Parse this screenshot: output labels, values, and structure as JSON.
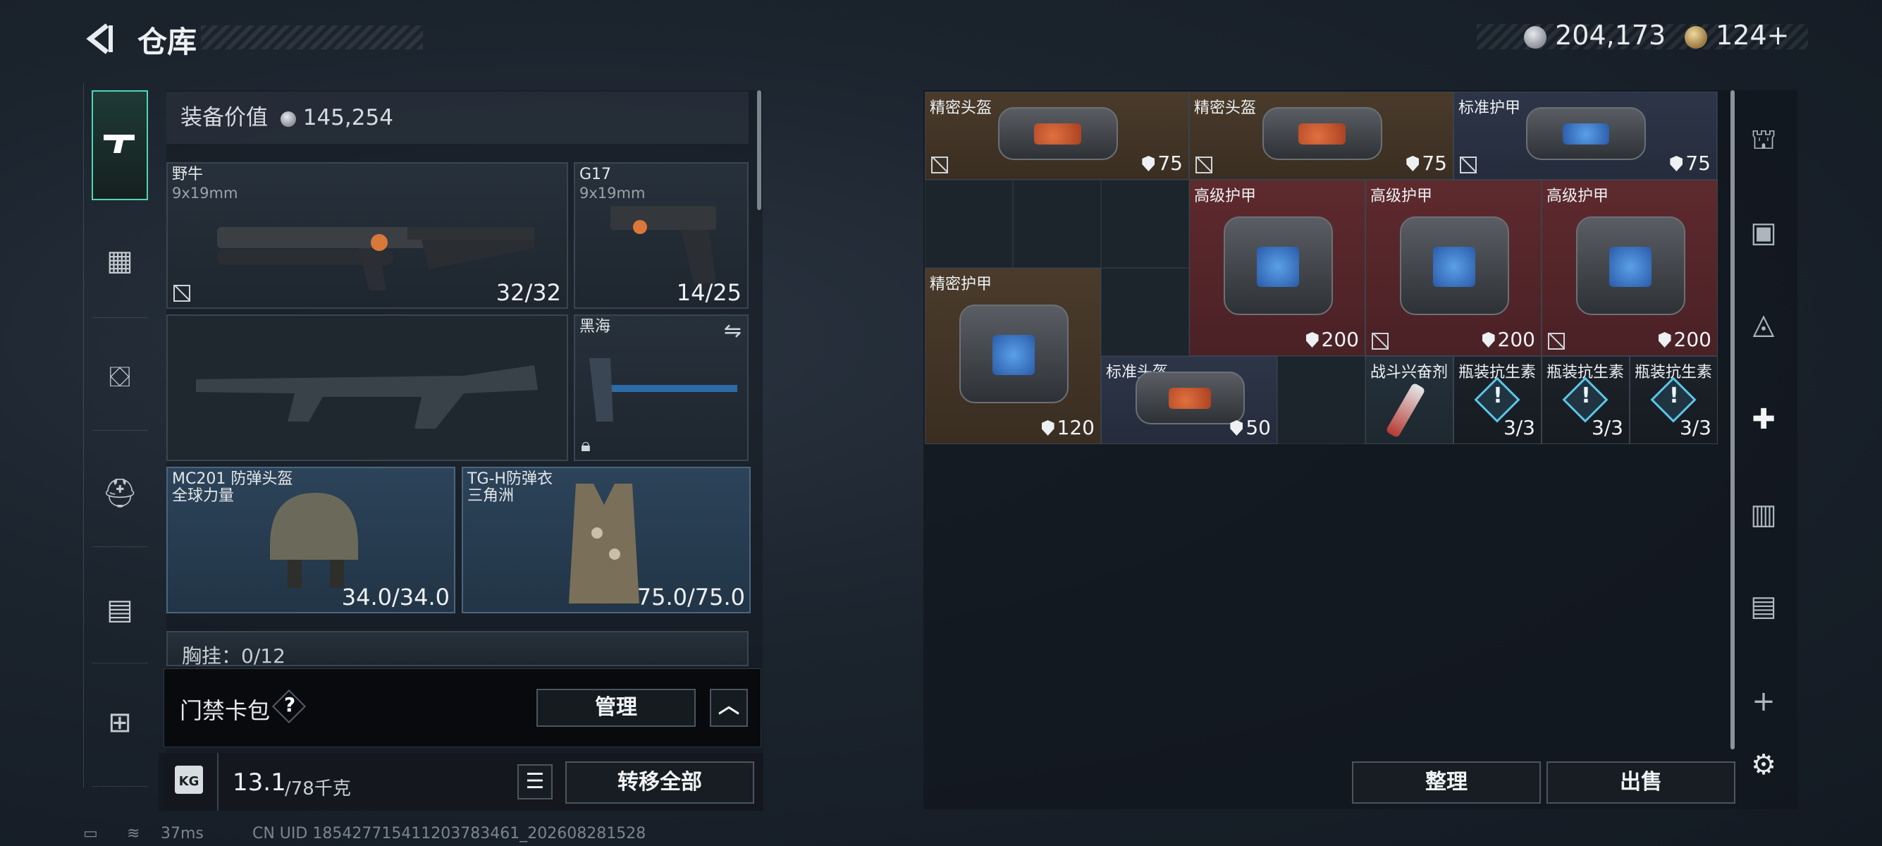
{
  "header": {
    "back_icon": "back-arrow-icon",
    "title": "仓库",
    "silver_amount": "204,173",
    "gold_amount": "124+"
  },
  "left_nav": {
    "items": [
      "weapon-icon",
      "chest-rig-icon",
      "backpack-icon",
      "helmet-backpack-icon",
      "container-icon",
      "toolbox-icon"
    ]
  },
  "equipment": {
    "value_label": "装备价值",
    "value_amount": "145,254",
    "primary": {
      "name": "野牛",
      "caliber": "9x19mm",
      "ammo": "32/32"
    },
    "pistol": {
      "name": "G17",
      "caliber": "9x19mm",
      "ammo": "14/25"
    },
    "melee": {
      "name": "黑海"
    },
    "helmet": {
      "name": "MC201 防弹头盔",
      "maker": "全球力量",
      "durability": "34.0/34.0"
    },
    "armor": {
      "name": "TG-H防弹衣",
      "maker": "三角洲",
      "durability": "75.0/75.0"
    },
    "chest_rig_partial": "胸挂：0/12",
    "card_pack_label": "门禁卡包",
    "card_pack_help": "?",
    "manage_label": "管理",
    "weight_current": "13.1",
    "weight_max": "/78千克",
    "transfer_all_label": "转移全部"
  },
  "stash": {
    "items": [
      {
        "name": "精密头盔",
        "value": "75",
        "color": "brown",
        "screen": "orange",
        "noinsure": true
      },
      {
        "name": "精密头盔",
        "value": "75",
        "color": "brown",
        "screen": "orange",
        "noinsure": true
      },
      {
        "name": "标准护甲",
        "value": "75",
        "color": "blueish",
        "screen": "blue",
        "noinsure": true
      },
      {
        "name": "高级护甲",
        "value": "200",
        "color": "red",
        "screen": "blue",
        "noinsure": false
      },
      {
        "name": "高级护甲",
        "value": "200",
        "color": "red",
        "screen": "blue",
        "noinsure": true
      },
      {
        "name": "高级护甲",
        "value": "200",
        "color": "red",
        "screen": "blue",
        "noinsure": true
      },
      {
        "name": "精密护甲",
        "value": "120",
        "color": "brown",
        "screen": "blue",
        "noinsure": false
      },
      {
        "name": "标准头盔",
        "value": "50",
        "color": "blueish",
        "screen": "orange",
        "noinsure": false
      },
      {
        "name": "战斗兴奋剂",
        "value": "",
        "color": "teal",
        "screen": "",
        "noinsure": false
      },
      {
        "name": "瓶装抗生素",
        "value": "3/3",
        "color": "dark",
        "screen": "",
        "noinsure": false
      },
      {
        "name": "瓶装抗生素",
        "value": "3/3",
        "color": "dark",
        "screen": "",
        "noinsure": false
      },
      {
        "name": "瓶装抗生素",
        "value": "3/3",
        "color": "dark",
        "screen": "",
        "noinsure": false
      }
    ],
    "sort_label": "整理",
    "sell_label": "出售"
  },
  "right_nav": {
    "items": [
      "stash-tab-1-icon",
      "stash-tab-4-icon",
      "stash-tab-2-icon",
      "stash-tab-medical-icon",
      "stash-tab-5-icon",
      "stash-tab-3-icon",
      "add-tab-icon",
      "settings-icon"
    ]
  },
  "status": {
    "ping": "37ms",
    "uid": "CN UID 18542771541120378346​1_202608281528"
  },
  "colors": {
    "accent": "#4fd6b3"
  }
}
